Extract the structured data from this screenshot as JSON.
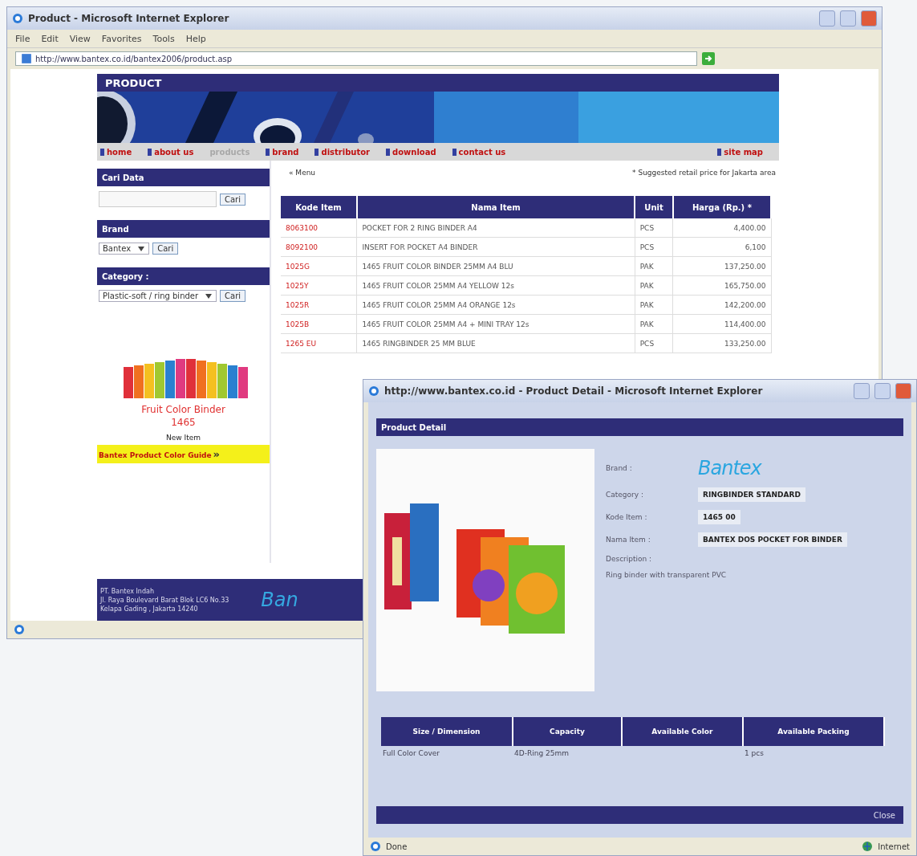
{
  "browser_window": {
    "title": "Product - Microsoft Internet Explorer",
    "menu": [
      "File",
      "Edit",
      "View",
      "Favorites",
      "Tools",
      "Help"
    ],
    "address": "http://www.bantex.co.id/bantex2006/product.asp",
    "page": {
      "banner_title": "PRODUCT",
      "nav": [
        {
          "label": "home",
          "selected": false
        },
        {
          "label": "about us",
          "selected": false
        },
        {
          "label": "products",
          "selected": true
        },
        {
          "label": "brand",
          "selected": false
        },
        {
          "label": "distributor",
          "selected": false
        },
        {
          "label": "download",
          "selected": false
        },
        {
          "label": "contact us",
          "selected": false
        },
        {
          "label": "site map",
          "selected": false
        }
      ],
      "search_panel": {
        "title": "Cari Data",
        "button": "Cari"
      },
      "brand_panel": {
        "title": "Brand",
        "value": "Bantex",
        "button": "Cari"
      },
      "category_panel": {
        "title": "Category :",
        "value": "Plastic-soft / ring binder",
        "button": "Cari"
      },
      "promo": {
        "title": "Fruit Color Binder",
        "code": "1465",
        "tag": "New Item",
        "guide_link": "Bantex Product Color Guide",
        "guide_arrow": "»"
      },
      "footer": {
        "lines": [
          "PT. Bantex Indah",
          "Jl. Raya Boulevard Barat Blok LC6 No.33",
          "Kelapa Gading , Jakarta 14240"
        ],
        "logo": "Ban"
      },
      "back_link": "« Menu",
      "note": "* Suggested retail price for Jakarta area",
      "table": {
        "columns": [
          "Kode Item",
          "Nama Item",
          "Unit",
          "Harga (Rp.) *"
        ],
        "rows": [
          [
            "8063100",
            "POCKET FOR 2 RING BINDER A4",
            "PCS",
            "4,400.00"
          ],
          [
            "8092100",
            "INSERT FOR POCKET A4 BINDER",
            "PCS",
            "6,100"
          ],
          [
            "1025G",
            "1465 FRUIT COLOR BINDER 25MM A4 BLU",
            "PAK",
            "137,250.00"
          ],
          [
            "1025Y",
            "1465 FRUIT COLOR 25MM A4 YELLOW 12s",
            "PAK",
            "165,750.00"
          ],
          [
            "1025R",
            "1465 FRUIT COLOR 25MM A4 ORANGE 12s",
            "PAK",
            "142,200.00"
          ],
          [
            "1025B",
            "1465 FRUIT COLOR 25MM A4 + MINI TRAY 12s",
            "PAK",
            "114,400.00"
          ],
          [
            "1265 EU",
            "1465 RINGBINDER 25 MM BLUE",
            "PCS",
            "133,250.00"
          ]
        ]
      }
    }
  },
  "popup_window": {
    "title": "http://www.bantex.co.id - Product Detail - Microsoft Internet Explorer",
    "heading": "Product Detail",
    "fields": [
      {
        "label": "Brand :",
        "value": "Bantex",
        "kind": "logo"
      },
      {
        "label": "Category :",
        "value": "RINGBINDER STANDARD",
        "kind": "box"
      },
      {
        "label": "Kode Item :",
        "value": "1465 00",
        "kind": "box"
      },
      {
        "label": "Nama Item :",
        "value": "BANTEX DOS POCKET FOR BINDER",
        "kind": "box"
      }
    ],
    "description_label": "Description :",
    "description": "Ring binder with transparent PVC",
    "table": {
      "columns": [
        "Size / Dimension",
        "Capacity",
        "Available Color",
        "Available Packing"
      ],
      "cells": [
        [
          "Full Color Cover"
        ],
        [
          "4D-Ring 25mm"
        ],
        [],
        [
          "1 pcs"
        ]
      ]
    },
    "close_link": "Close",
    "status": "Done",
    "zone": "Internet"
  }
}
